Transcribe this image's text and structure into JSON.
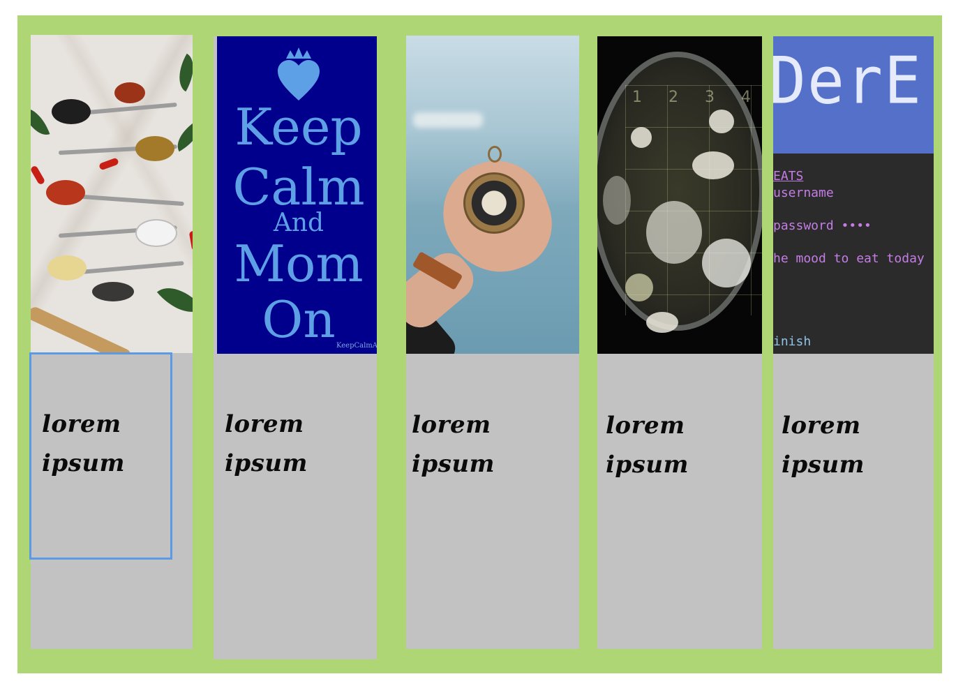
{
  "cards": [
    {
      "title": "lorem ipsum",
      "image": "spices-on-spoons"
    },
    {
      "title": "lorem ipsum",
      "image": "keep-calm-poster"
    },
    {
      "title": "lorem ipsum",
      "image": "hand-holding-compass"
    },
    {
      "title": "lorem ipsum",
      "image": "petri-dish"
    },
    {
      "title": "lorem ipsum",
      "image": "terminal-screenshot"
    }
  ],
  "poster": {
    "line1": "Keep",
    "line2": "Calm",
    "line3": "And",
    "line4": "Mom",
    "line5": "On",
    "watermark": "KeepCalmA"
  },
  "petri": {
    "grid_numbers": [
      "1",
      "2",
      "3",
      "4"
    ]
  },
  "terminal": {
    "ascii_banner": "DerE",
    "lines": [
      {
        "text": "EATS",
        "color": "#c57de6"
      },
      {
        "text": " username",
        "color": "#c57de6"
      },
      {
        "text": " password ••••",
        "color": "#c57de6"
      },
      {
        "text": "he mood to eat today",
        "color": "#c57de6"
      },
      {
        "text": "inish",
        "color": "#8fc4e8"
      }
    ]
  },
  "colors": {
    "background_panel": "#aed674",
    "card_body": "#c2c2c2",
    "selection_outline": "#5b9be6",
    "poster_bg": "#00008d",
    "poster_text": "#5ea0e6",
    "terminal_header": "#5570c8"
  }
}
